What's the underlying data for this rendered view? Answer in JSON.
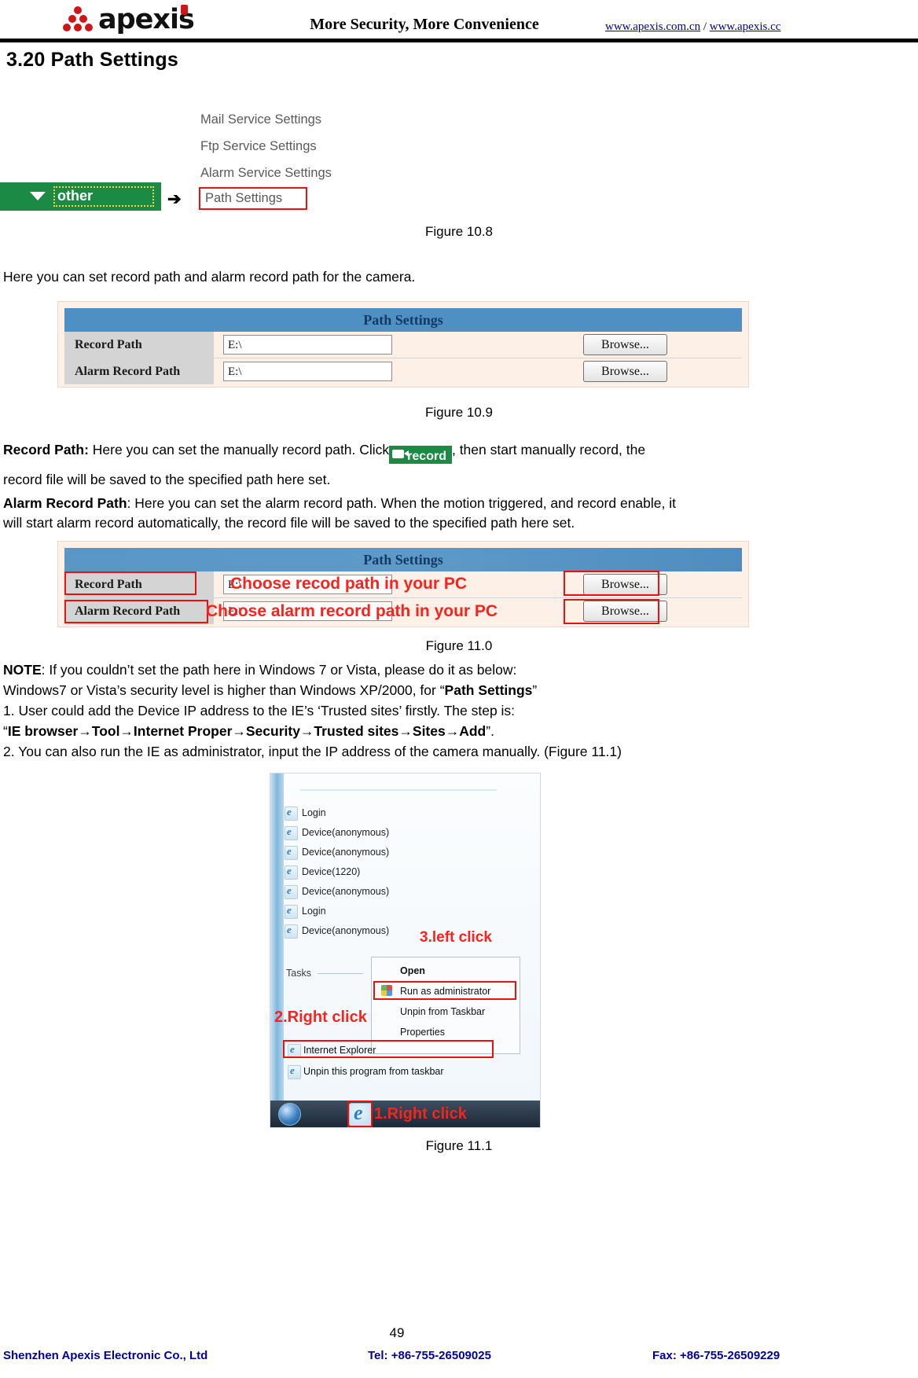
{
  "header": {
    "logo_text": "apexis",
    "tagline": "More Security, More Convenience",
    "link1": "www.apexis.com.cn",
    "link_sep": " / ",
    "link2": "www.apexis.cc"
  },
  "section": {
    "title": "3.20 Path Settings"
  },
  "figure_10_8": {
    "other_button_label": "other",
    "arrow": "➔",
    "menu_items": [
      "Mail Service Settings",
      "Ftp Service Settings",
      "Alarm Service Settings"
    ],
    "highlighted_item": "Path Settings",
    "caption": "Figure 10.8"
  },
  "intro_text": "Here you can set record path and alarm record path for the camera.",
  "figure_10_9": {
    "table_title": "Path Settings",
    "rows": [
      {
        "label": "Record Path",
        "value": "E:\\",
        "button": "Browse..."
      },
      {
        "label": "Alarm Record Path",
        "value": "E:\\",
        "button": "Browse..."
      }
    ],
    "caption": "Figure 10.9"
  },
  "body": {
    "p1_bold": "Record Path:",
    "p1_a": " Here you can set the manually record path. Click",
    "record_button_label": "record",
    "p1_b": ", then start manually record, the",
    "p1_c": "record file will be saved to the specified path here set.",
    "p2_bold": "Alarm Record Path",
    "p2_a": ": Here you can set the alarm record path. When the motion triggered, and record enable, it",
    "p2_b": "will start alarm record automatically, the record file will be saved to the specified path here set."
  },
  "figure_11_0": {
    "table_title": "Path Settings",
    "rows": [
      {
        "label": "Record Path",
        "value": "E:\\",
        "button": "Browse...",
        "annotation": "Choose recod path in your PC"
      },
      {
        "label": "Alarm Record Path",
        "value": "E:\\",
        "button": "Browse...",
        "annotation": "Choose alarm record path in your PC"
      }
    ],
    "caption": "Figure 11.0"
  },
  "note": {
    "note_bold": "NOTE",
    "line1": ": If you couldn’t set the path here in Windows 7 or Vista, please do it as below:",
    "line2_a": "Windows7 or Vista’s security level is higher than Windows XP/2000, for “",
    "line2_bold": "Path Settings",
    "line2_b": "”",
    "line3": "1. User could add the Device IP address to the IE’s ‘Trusted sites’ firstly. The step is:",
    "line4_q1": "“",
    "line4_bold": "IE browser→Tool→Internet Proper→Security→Trusted sites→Sites→Add",
    "line4_q2": "”.",
    "line5": "2. You can also run the IE as administrator, input the IP address of the camera manually. (Figure 11.1)"
  },
  "figure_11_1": {
    "jumplist_items": [
      "Login",
      "Device(anonymous)",
      "Device(anonymous)",
      "Device(1220)",
      "Device(anonymous)",
      "Login",
      "Device(anonymous)"
    ],
    "tasks_label": "Tasks",
    "context_menu": [
      "Open",
      "Run as administrator",
      "Unpin from Taskbar",
      "Properties"
    ],
    "pinned_item": "Internet Explorer",
    "unpin_item": "Unpin this program from taskbar",
    "annotation_1": "1.Right click",
    "annotation_2": "2.Right click",
    "annotation_3": "3.left click",
    "caption": "Figure 11.1"
  },
  "footer": {
    "page_number": "49",
    "company": "Shenzhen Apexis Electronic Co., Ltd",
    "tel": "Tel: +86-755-26509025",
    "fax": "Fax: +86-755-26509229"
  }
}
